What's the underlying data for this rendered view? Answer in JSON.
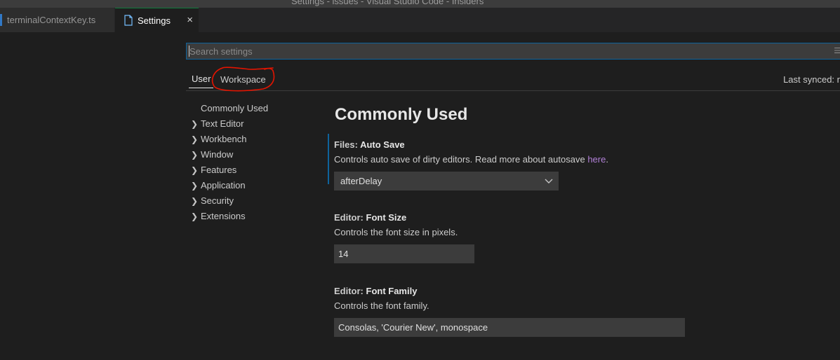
{
  "window": {
    "title": "Settings - issues - Visual Studio Code - Insiders"
  },
  "tabs": [
    {
      "label": "terminalContextKey.ts"
    },
    {
      "label": "Settings",
      "close": "×"
    }
  ],
  "search": {
    "placeholder": "Search settings",
    "filter_glyph": "☰"
  },
  "scope": {
    "user": "User",
    "workspace": "Workspace",
    "last_synced": "Last synced: r"
  },
  "toc": [
    {
      "label": "Commonly Used",
      "expandable": false
    },
    {
      "label": "Text Editor",
      "expandable": true
    },
    {
      "label": "Workbench",
      "expandable": true
    },
    {
      "label": "Window",
      "expandable": true
    },
    {
      "label": "Features",
      "expandable": true
    },
    {
      "label": "Application",
      "expandable": true
    },
    {
      "label": "Security",
      "expandable": true
    },
    {
      "label": "Extensions",
      "expandable": true
    }
  ],
  "content": {
    "section_title": "Commonly Used",
    "settings": [
      {
        "category": "Files: ",
        "name": "Auto Save",
        "description": "Controls auto save of dirty editors. Read more about autosave ",
        "link": "here",
        "after_link": ".",
        "value": "afterDelay"
      },
      {
        "category": "Editor: ",
        "name": "Font Size",
        "description": "Controls the font size in pixels.",
        "value": "14"
      },
      {
        "category": "Editor: ",
        "name": "Font Family",
        "description": "Controls the font family.",
        "value": "Consolas, 'Courier New', monospace"
      }
    ]
  },
  "colors": {
    "accent": "#0e639c",
    "link": "#b180d7",
    "annotation": "#e51400"
  }
}
